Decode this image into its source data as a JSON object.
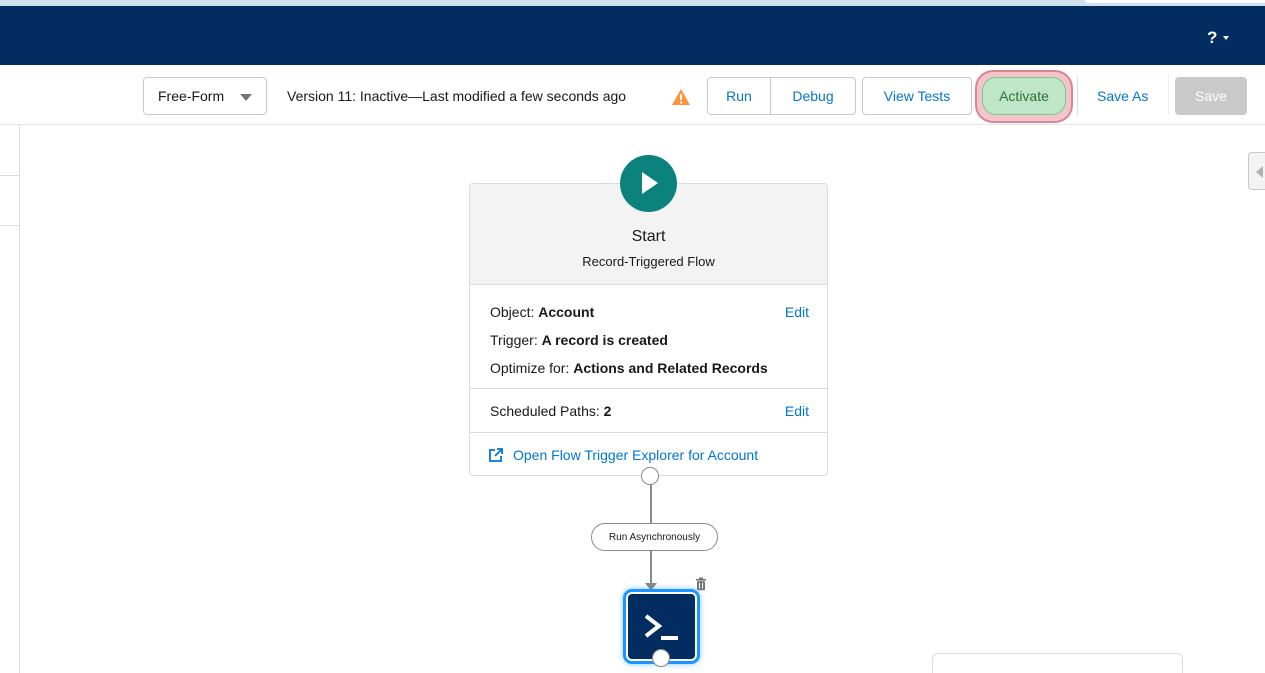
{
  "header": {
    "help_label": "?"
  },
  "toolbar": {
    "layout_select_value": "Free-Form",
    "version_status": "Version 11: Inactive—Last modified a few seconds ago",
    "run_label": "Run",
    "debug_label": "Debug",
    "view_tests_label": "View Tests",
    "activate_label": "Activate",
    "save_as_label": "Save As",
    "save_label": "Save"
  },
  "start_element": {
    "title": "Start",
    "subtitle": "Record-Triggered Flow",
    "object_label": "Object:",
    "object_value": "Account",
    "trigger_label": "Trigger:",
    "trigger_value": "A record is created",
    "optimize_label": "Optimize for:",
    "optimize_value": "Actions and Related Records",
    "edit_label": "Edit",
    "scheduled_paths_label": "Scheduled Paths:",
    "scheduled_paths_value": "2",
    "explorer_link": "Open Flow Trigger Explorer for Account"
  },
  "canvas": {
    "path_label": "Run Asynchronously"
  },
  "colors": {
    "nav": "#032d60",
    "brand_link": "#0176d3",
    "start_icon": "#0b827c",
    "warning": "#fe9339",
    "activate_highlight": "#bfe6c7",
    "selection_glow": "#1b96ff"
  },
  "icons": {
    "warning": "warning-triangle-icon",
    "external_link": "external-link-icon",
    "trash": "trash-icon",
    "apex_action": "apex-terminal-icon",
    "start": "play-icon"
  }
}
